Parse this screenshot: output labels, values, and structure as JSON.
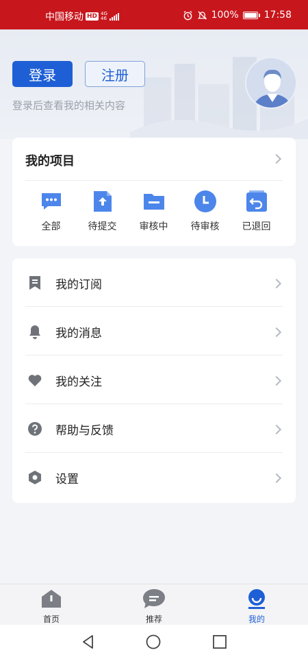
{
  "status_bar": {
    "carrier": "中国移动",
    "hd": "HD",
    "network_top": "4G",
    "network_bottom": "46",
    "battery_percent": "100%",
    "time": "17:58",
    "icons": [
      "alarm-icon",
      "mute-icon",
      "battery-icon"
    ]
  },
  "header": {
    "login_label": "登录",
    "register_label": "注册",
    "hint": "登录后查看我的相关内容",
    "avatar_icon": "avatar-placeholder"
  },
  "projects": {
    "title": "我的项目",
    "items": [
      {
        "label": "全部",
        "icon": "chat-bubble-icon"
      },
      {
        "label": "待提交",
        "icon": "upload-file-icon"
      },
      {
        "label": "审核中",
        "icon": "folder-icon"
      },
      {
        "label": "待审核",
        "icon": "clock-icon"
      },
      {
        "label": "已退回",
        "icon": "return-icon"
      }
    ]
  },
  "menu": {
    "items": [
      {
        "label": "我的订阅",
        "icon": "bookmark-icon"
      },
      {
        "label": "我的消息",
        "icon": "bell-icon"
      },
      {
        "label": "我的关注",
        "icon": "heart-icon"
      },
      {
        "label": "帮助与反馈",
        "icon": "question-icon"
      },
      {
        "label": "设置",
        "icon": "settings-icon"
      }
    ]
  },
  "tabbar": {
    "tabs": [
      {
        "label": "首页",
        "icon": "home-icon",
        "active": false
      },
      {
        "label": "推荐",
        "icon": "chat-icon",
        "active": false
      },
      {
        "label": "我的",
        "icon": "profile-icon",
        "active": true
      }
    ]
  },
  "colors": {
    "status_bar": "#c8161d",
    "primary": "#1e5fd6",
    "icon_blue": "#4c86ea",
    "icon_gray": "#6f7379"
  }
}
